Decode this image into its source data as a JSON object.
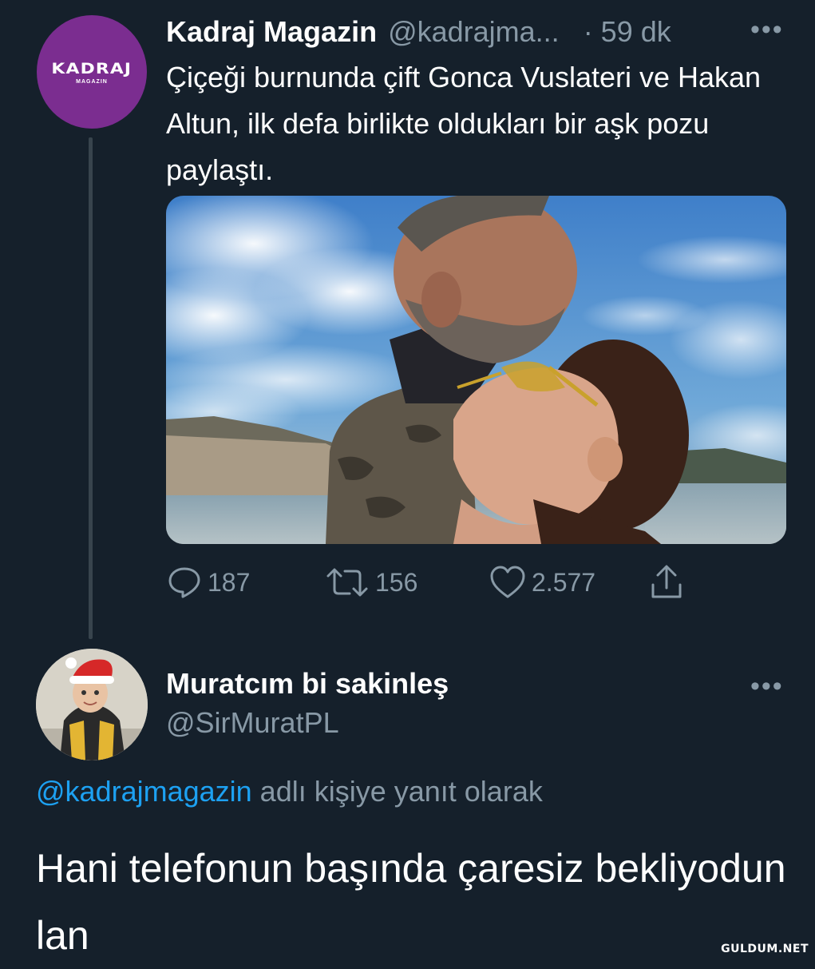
{
  "tweet1": {
    "avatar": {
      "logo_text": "KADRAJ",
      "logo_subtext": "MAGAZIN",
      "bg_color": "#7b2d90"
    },
    "display_name": "Kadraj Magazin",
    "handle": "@kadrajma...",
    "time": "· 59 dk",
    "more_icon": "•••",
    "text": "Çiçeği burnunda çift Gonca Vuslateri ve Hakan Altun, ilk defa birlikte oldukları bir aşk pozu paylaştı.",
    "actions": {
      "reply_count": "187",
      "retweet_count": "156",
      "like_count": "2.577"
    }
  },
  "tweet2": {
    "display_name": "Muratcım bi sakinleş",
    "handle": "@SirMuratPL",
    "more_icon": "•••",
    "reply_mention": "@kadrajmagazin",
    "reply_suffix": " adlı kişiye yanıt olarak",
    "text": "Hani telefonun başında çaresiz bekliyodun lan"
  },
  "watermark": "GULDUM.NET",
  "colors": {
    "background": "#15202b",
    "secondary_text": "#8899a6",
    "link": "#1da1f2",
    "thread_line": "#38444d"
  }
}
